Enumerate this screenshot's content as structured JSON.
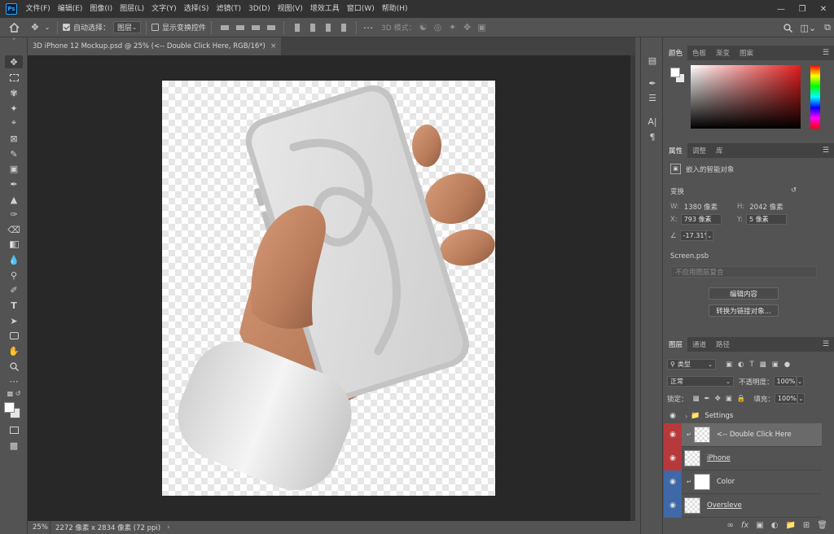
{
  "menu": {
    "items": [
      "文件(F)",
      "编辑(E)",
      "图像(I)",
      "图层(L)",
      "文字(Y)",
      "选择(S)",
      "滤镜(T)",
      "3D(D)",
      "视图(V)",
      "增效工具",
      "窗口(W)",
      "帮助(H)"
    ]
  },
  "options": {
    "auto_select_label": "自动选择：",
    "auto_select_value": "图层",
    "show_transform_label": "显示变换控件",
    "mode_3d_label": "3D 模式："
  },
  "document": {
    "tab_title": "3D iPhone 12 Mockup.psd @ 25% (<-- Double Click Here, RGB/16*)",
    "zoom": "25%",
    "status_info": "2272 像素 x 2834 像素 (72 ppi)"
  },
  "color_panel": {
    "tabs": [
      "颜色",
      "色板",
      "渐变",
      "图案"
    ],
    "accent_hue": "#e51c1c"
  },
  "properties_panel": {
    "tabs": [
      "属性",
      "调整",
      "库"
    ],
    "object_type": "嵌入的智能对象",
    "section_transform": "变换",
    "w_label": "W:",
    "w_value": "1380 像素",
    "h_label": "H:",
    "h_value": "2042 像素",
    "x_label": "X:",
    "x_value": "793 像素",
    "y_label": "Y:",
    "y_value": "5 像素",
    "angle_value": "-17.31°",
    "linked_file": "Screen.psb",
    "comp_placeholder": "不应用图层复合",
    "edit_contents_label": "编辑内容",
    "convert_linked_label": "转换为链接对象..."
  },
  "layers_panel": {
    "tabs": [
      "图层",
      "通道",
      "路径"
    ],
    "filter_kind": "类型",
    "blend_mode": "正常",
    "opacity_label": "不透明度：",
    "opacity_value": "100%",
    "lock_label": "锁定：",
    "fill_label": "填充：",
    "fill_value": "100%",
    "layers": [
      {
        "name": "Settings",
        "color": "none"
      },
      {
        "name": "<-- Double Click Here",
        "color": "red"
      },
      {
        "name": "iPhone",
        "color": "red"
      },
      {
        "name": "Color",
        "color": "blue"
      },
      {
        "name": "Oversleve",
        "color": "blue"
      }
    ]
  }
}
